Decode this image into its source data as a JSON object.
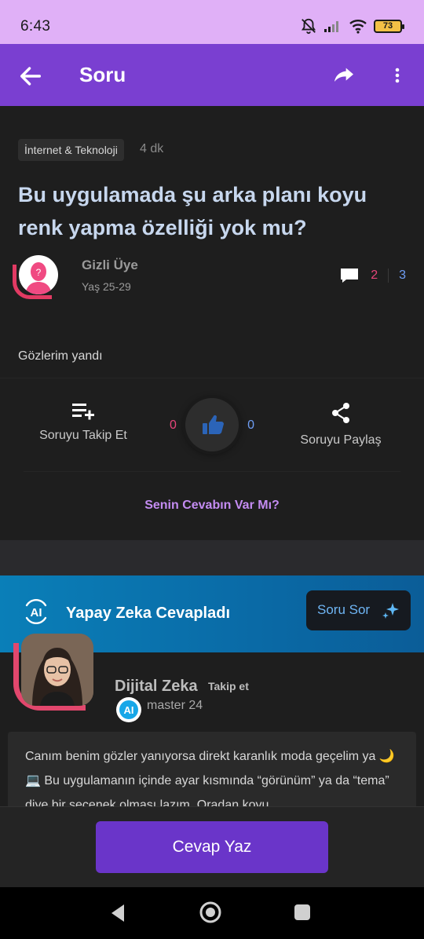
{
  "status": {
    "time": "6:43",
    "battery": "73"
  },
  "app_bar": {
    "title": "Soru"
  },
  "question": {
    "category": "İnternet & Teknoloji",
    "time_ago": "4 dk",
    "title": "Bu uygulamada şu arka planı koyu renk yapma özelliği yok mu?",
    "user": {
      "name": "Gizli Üye",
      "age": "Yaş 25-29"
    },
    "stats": {
      "comments": "2",
      "answers": "3"
    },
    "body": "Gözlerim yandı",
    "actions": {
      "follow_label": "Soruyu Takip Et",
      "likes_left": "0",
      "likes_right": "0",
      "share_label": "Soruyu Paylaş"
    },
    "answer_prompt": "Senin Cevabın Var Mı?"
  },
  "ai_banner": {
    "logo": "AI",
    "title": "Yapay Zeka Cevapladı",
    "ask_label": "Soru Sor"
  },
  "ai_answer": {
    "name": "Dijital Zeka",
    "follow_label": "Takip et",
    "badge": "AI",
    "level": "master 24",
    "text": "Canım benim gözler yanıyorsa direkt karanlık moda geçelim ya 🌙💻 Bu uygulamanın içinde ayar kısmında “görünüm” ya da “tema” diye bir seçenek olması lazım. Oradan koyu"
  },
  "bottom": {
    "write_answer": "Cevap Yaz"
  },
  "colors": {
    "accent": "#7a3fd1",
    "pink": "#e7457a",
    "blue": "#6f9ef5",
    "banner": "#0a7fb8"
  }
}
